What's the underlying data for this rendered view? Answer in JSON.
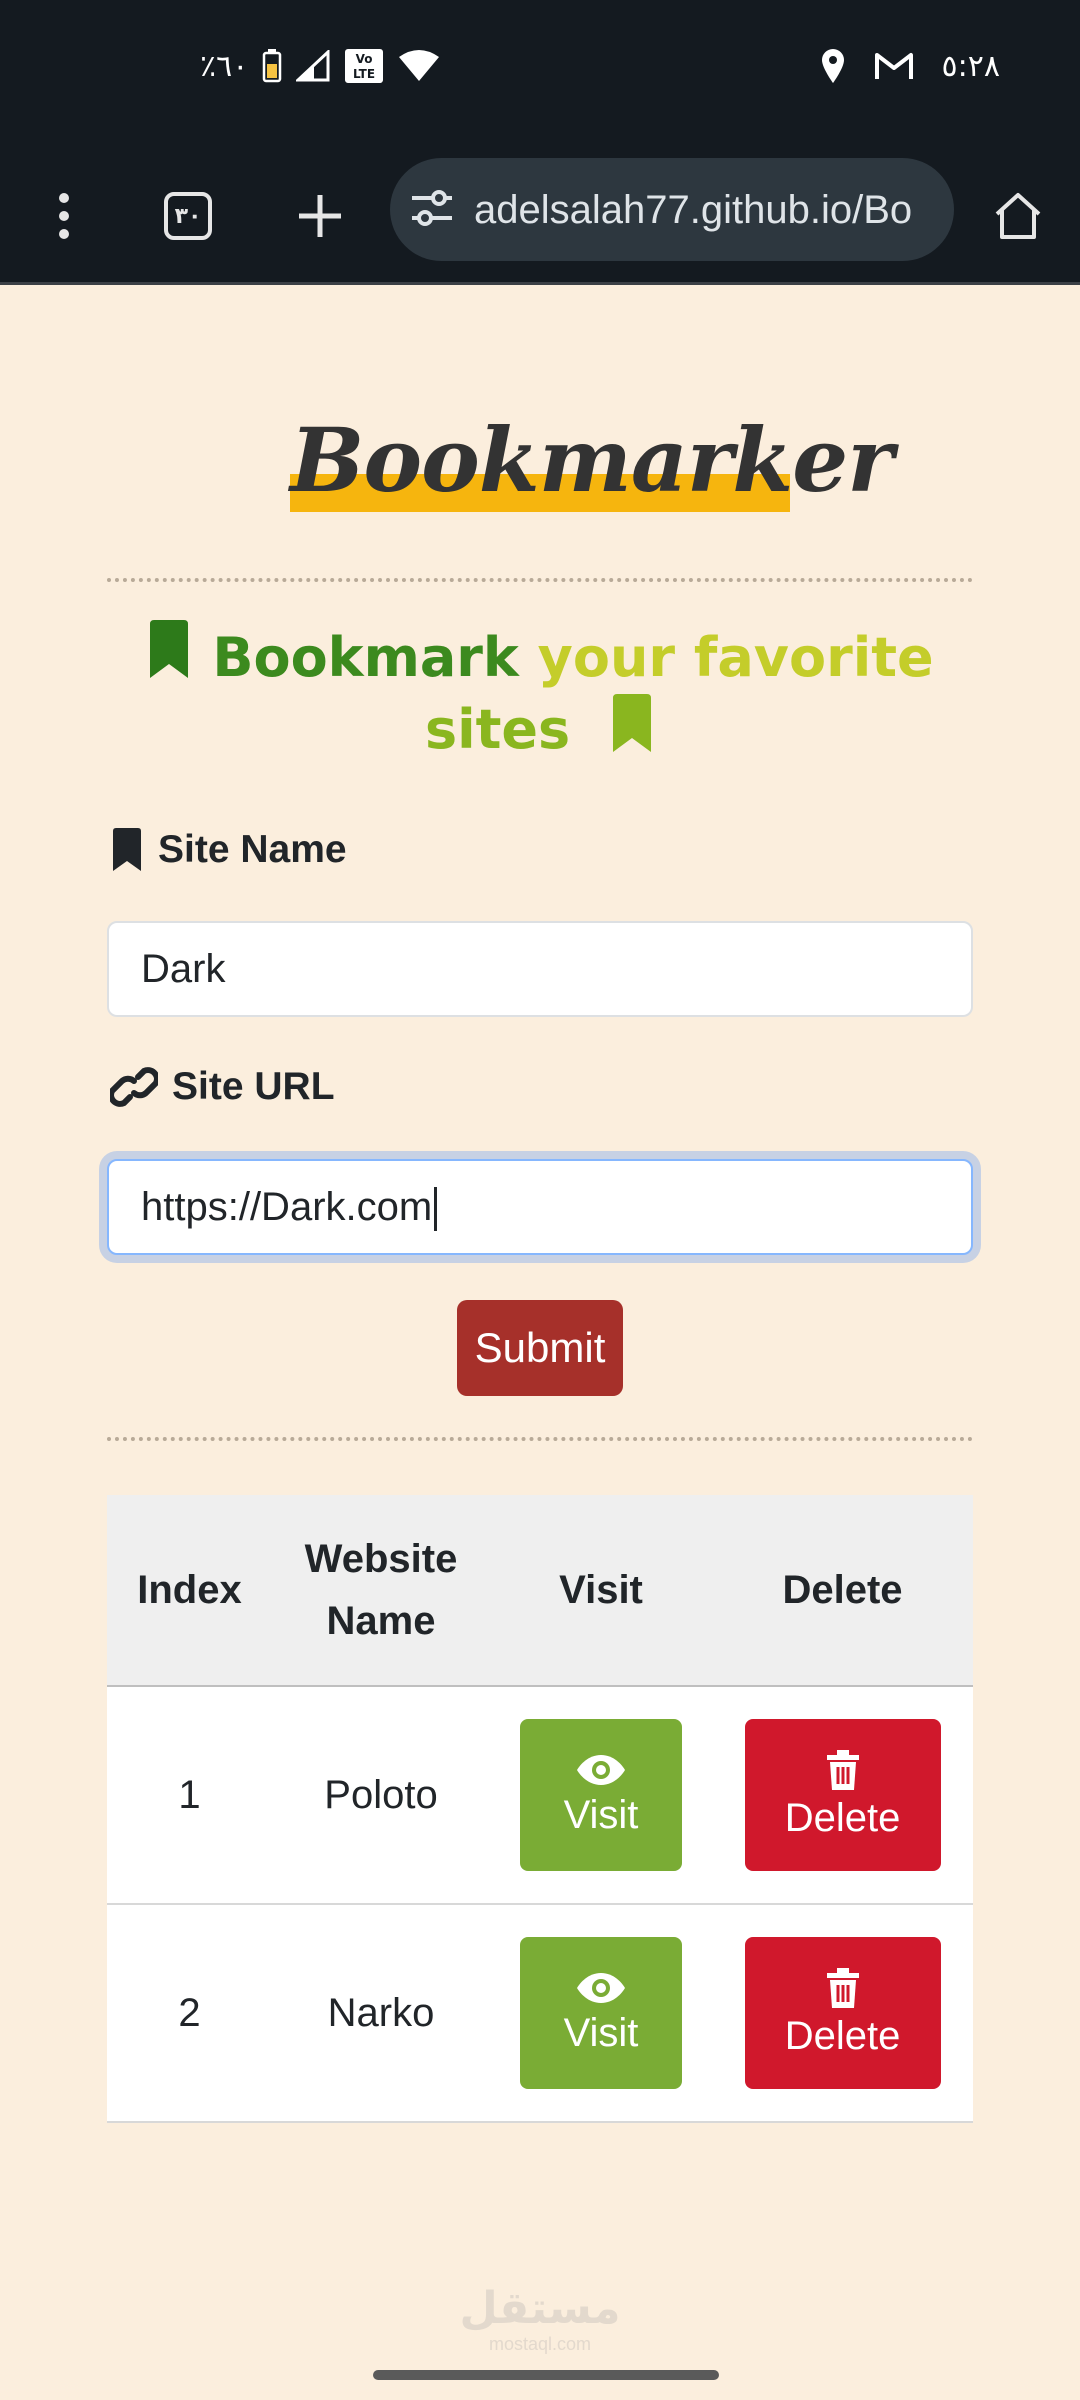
{
  "status_bar": {
    "battery_text": "٪٦٠",
    "time": "٥:٢٨",
    "volte_label": "Vo LTE",
    "icons": [
      "battery-icon",
      "signal-icon",
      "volte-icon",
      "wifi-icon",
      "location-icon",
      "gmail-icon"
    ]
  },
  "browser": {
    "tab_count": "٣٠",
    "url": "adelsalah77.github.io/Bo",
    "icons": [
      "menu-icon",
      "tabs-icon",
      "new-tab-icon",
      "site-settings-icon",
      "home-icon"
    ]
  },
  "app": {
    "logo": "Bookmarker",
    "tagline": {
      "word1": "Bookmark",
      "word2": "your favorite",
      "word3": "sites"
    },
    "form": {
      "site_name_label": "Site Name",
      "site_name_value": "Dark",
      "site_url_label": "Site URL",
      "site_url_value": "https://Dark.com",
      "submit_label": "Submit"
    },
    "table": {
      "headers": [
        "Index",
        "Website Name",
        "Visit",
        "Delete"
      ],
      "header_name_line1": "Website",
      "header_name_line2": "Name",
      "rows": [
        {
          "index": "1",
          "name": "Poloto",
          "visit": "Visit",
          "delete": "Delete"
        },
        {
          "index": "2",
          "name": "Narko",
          "visit": "Visit",
          "delete": "Delete"
        }
      ]
    }
  },
  "watermark": {
    "arabic": "مستقل",
    "latin": "mostaql.com"
  },
  "colors": {
    "background": "#fbeedd",
    "logo_highlight": "#f6b50e",
    "submit": "#a6302a",
    "visit": "#7aac35",
    "delete": "#d0182c",
    "tag_green_dark": "#3c8a1e",
    "tag_green_light": "#8ab61f"
  }
}
